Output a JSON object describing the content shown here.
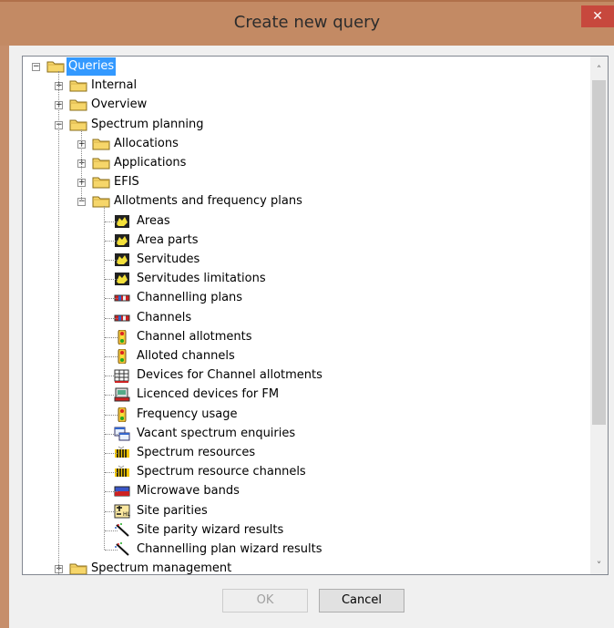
{
  "window": {
    "title": "Create new query",
    "close_glyph": "✕"
  },
  "tree": {
    "root": "Queries",
    "internal": "Internal",
    "overview": "Overview",
    "spectrum_planning": "Spectrum planning",
    "allocations": "Allocations",
    "applications": "Applications",
    "efis": "EFIS",
    "allotments": "Allotments and frequency plans",
    "leaves": [
      {
        "label": "Areas",
        "icon": "area-map-icon"
      },
      {
        "label": "Area parts",
        "icon": "area-map-icon"
      },
      {
        "label": "Servitudes",
        "icon": "area-map-icon"
      },
      {
        "label": "Servitudes limitations",
        "icon": "area-map-icon"
      },
      {
        "label": "Channelling plans",
        "icon": "channel-bar-icon"
      },
      {
        "label": "Channels",
        "icon": "channel-bar-icon"
      },
      {
        "label": "Channel allotments",
        "icon": "traffic-light-icon"
      },
      {
        "label": "Alloted channels",
        "icon": "traffic-light-icon"
      },
      {
        "label": "Devices for Channel allotments",
        "icon": "device-grid-icon"
      },
      {
        "label": "Licenced devices for FM",
        "icon": "licence-device-icon"
      },
      {
        "label": "Frequency usage",
        "icon": "traffic-light-icon"
      },
      {
        "label": "Vacant spectrum enquiries",
        "icon": "window-query-icon"
      },
      {
        "label": "Spectrum resources",
        "icon": "spectrum-resource-icon"
      },
      {
        "label": "Spectrum resource channels",
        "icon": "spectrum-resource-icon"
      },
      {
        "label": "Microwave bands",
        "icon": "microwave-band-icon"
      },
      {
        "label": "Site parities",
        "icon": "site-parity-icon"
      },
      {
        "label": "Site parity wizard results",
        "icon": "wizard-wand-icon"
      },
      {
        "label": "Channelling plan wizard results",
        "icon": "wizard-wand-icon"
      }
    ],
    "spectrum_management": "Spectrum management"
  },
  "buttons": {
    "ok": "OK",
    "cancel": "Cancel"
  },
  "colors": {
    "selection": "#3399ff",
    "folder": "#f6d66a",
    "titlebar": "#c38a64",
    "close": "#c7483d"
  }
}
